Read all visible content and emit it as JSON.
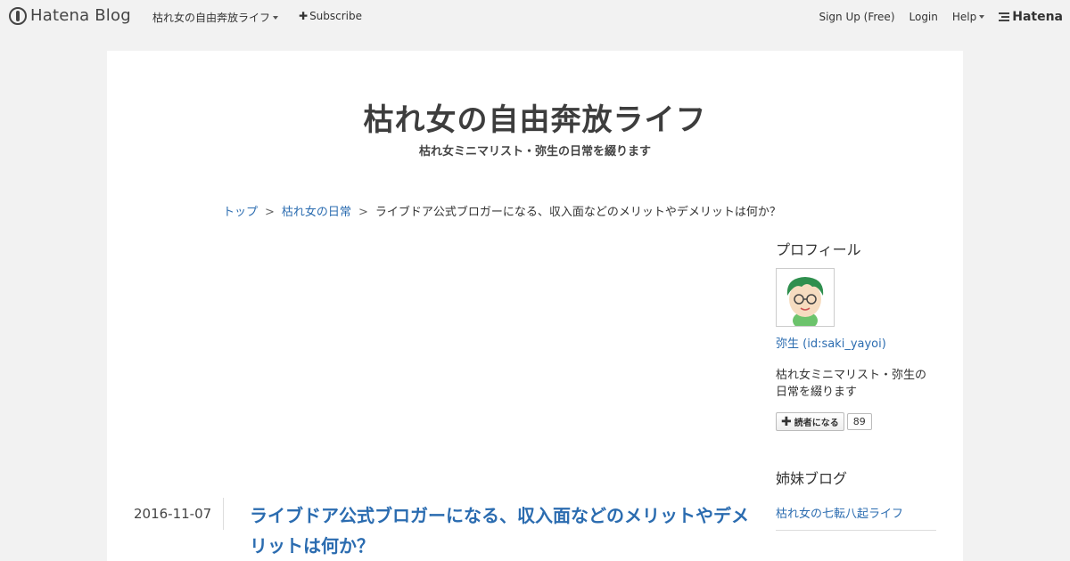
{
  "topbar": {
    "logo_text": "Hatena Blog",
    "blog_menu": "枯れ女の自由奔放ライフ",
    "subscribe": "Subscribe",
    "signup": "Sign Up (Free)",
    "login": "Login",
    "help": "Help",
    "hatena": "Hatena"
  },
  "header": {
    "title": "枯れ女の自由奔放ライフ",
    "description": "枯れ女ミニマリスト・弥生の日常を綴ります"
  },
  "breadcrumb": {
    "top": "トップ",
    "category": "枯れ女の日常",
    "current": "ライブドア公式ブロガーになる、収入面などのメリットやデメリットは何か？",
    "sep": ">"
  },
  "post": {
    "date": "2016-11-07",
    "title": "ライブドア公式ブロガーになる、収入面などのメリットやデメリットは何か？"
  },
  "sidebar": {
    "profile_heading": "プロフィール",
    "user_link": "弥生 (id:saki_yayoi)",
    "user_desc": "枯れ女ミニマリスト・弥生の日常を綴ります",
    "reader_button": "読者になる",
    "reader_count": "89",
    "sister_heading": "姉妹ブログ",
    "sister_link": "枯れ女の七転八起ライフ"
  }
}
